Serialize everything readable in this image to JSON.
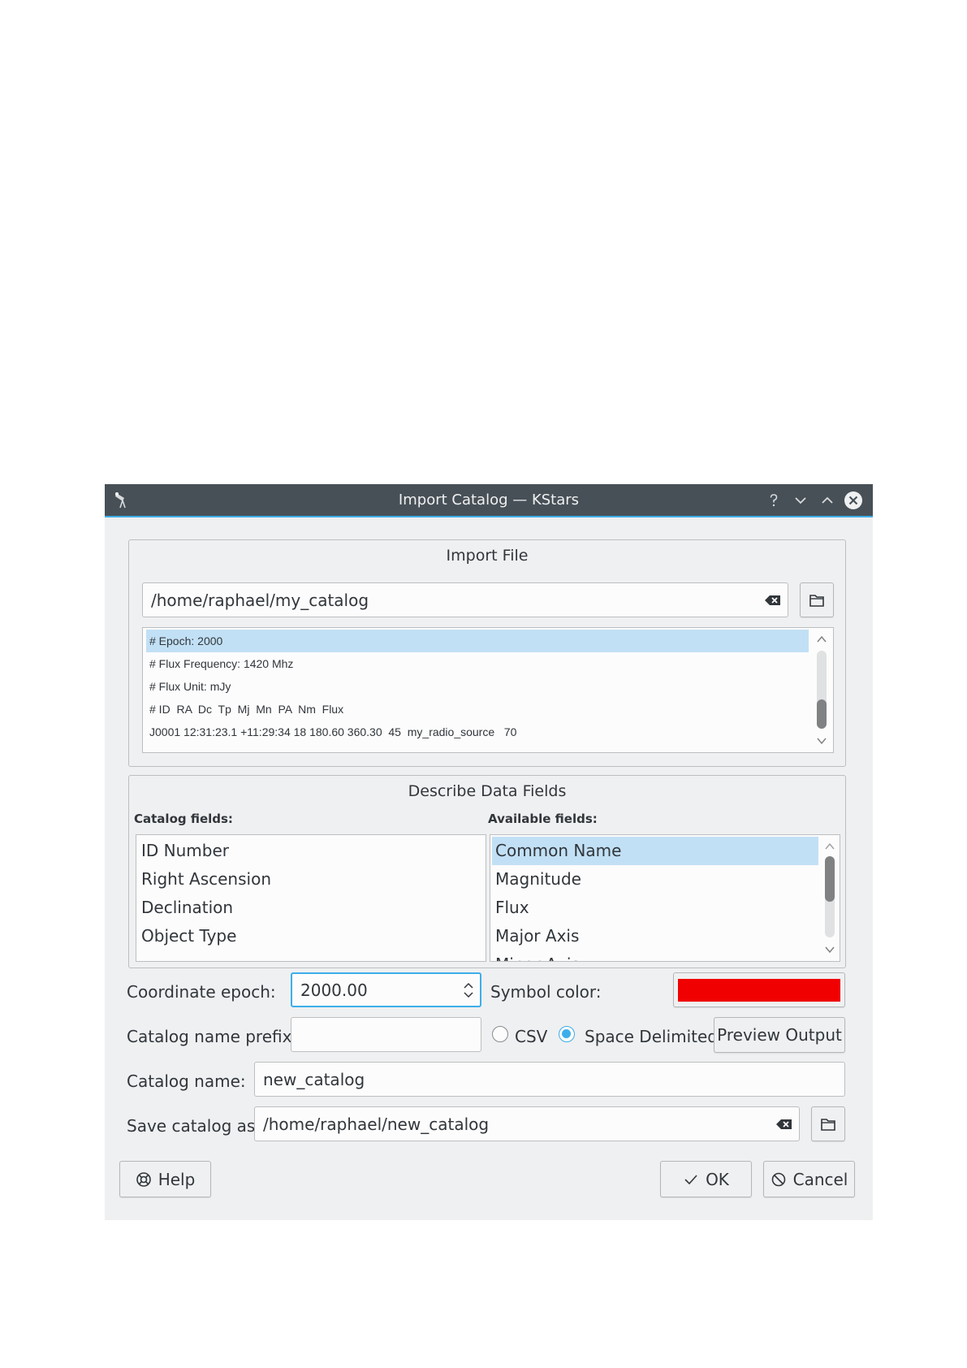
{
  "window": {
    "title": "Import Catalog — KStars",
    "titlebar_buttons": [
      "help-icon",
      "minimize-icon",
      "maximize-icon",
      "close-icon"
    ]
  },
  "import_file": {
    "group_title": "Import File",
    "path": "/home/raphael/my_catalog",
    "preview_lines": [
      "# Epoch: 2000",
      "# Flux Frequency: 1420 Mhz",
      "# Flux Unit: mJy",
      "# ID  RA  Dc  Tp  Mj  Mn  PA  Nm  Flux",
      "J0001 12:31:23.1 +11:29:34 18 180.60 360.30  45  my_radio_source   70"
    ]
  },
  "describe": {
    "group_title": "Describe Data Fields",
    "catalog_fields_label": "Catalog fields:",
    "available_fields_label": "Available fields:",
    "catalog_fields": [
      "ID Number",
      "Right Ascension",
      "Declination",
      "Object Type"
    ],
    "available_fields": [
      "Common Name",
      "Magnitude",
      "Flux",
      "Major Axis",
      "Minor Axis"
    ]
  },
  "form": {
    "epoch_label": "Coordinate epoch:",
    "epoch_value": "2000.00",
    "symbol_color_label": "Symbol color:",
    "symbol_color": "#f00000",
    "prefix_label": "Catalog name prefix:",
    "prefix_value": "",
    "csv_label": "CSV",
    "space_label": "Space Delimited",
    "preview_button": "Preview Output",
    "name_label": "Catalog name:",
    "name_value": "new_catalog",
    "save_label": "Save catalog as:",
    "save_value": "/home/raphael/new_catalog",
    "selected_delimiter": "Space Delimited"
  },
  "buttons": {
    "help": "Help",
    "ok": "OK",
    "cancel": "Cancel"
  },
  "colors": {
    "titlebar": "#475057",
    "accent": "#3daee9",
    "selection": "#c2e0f5",
    "window_bg": "#eff0f1"
  }
}
